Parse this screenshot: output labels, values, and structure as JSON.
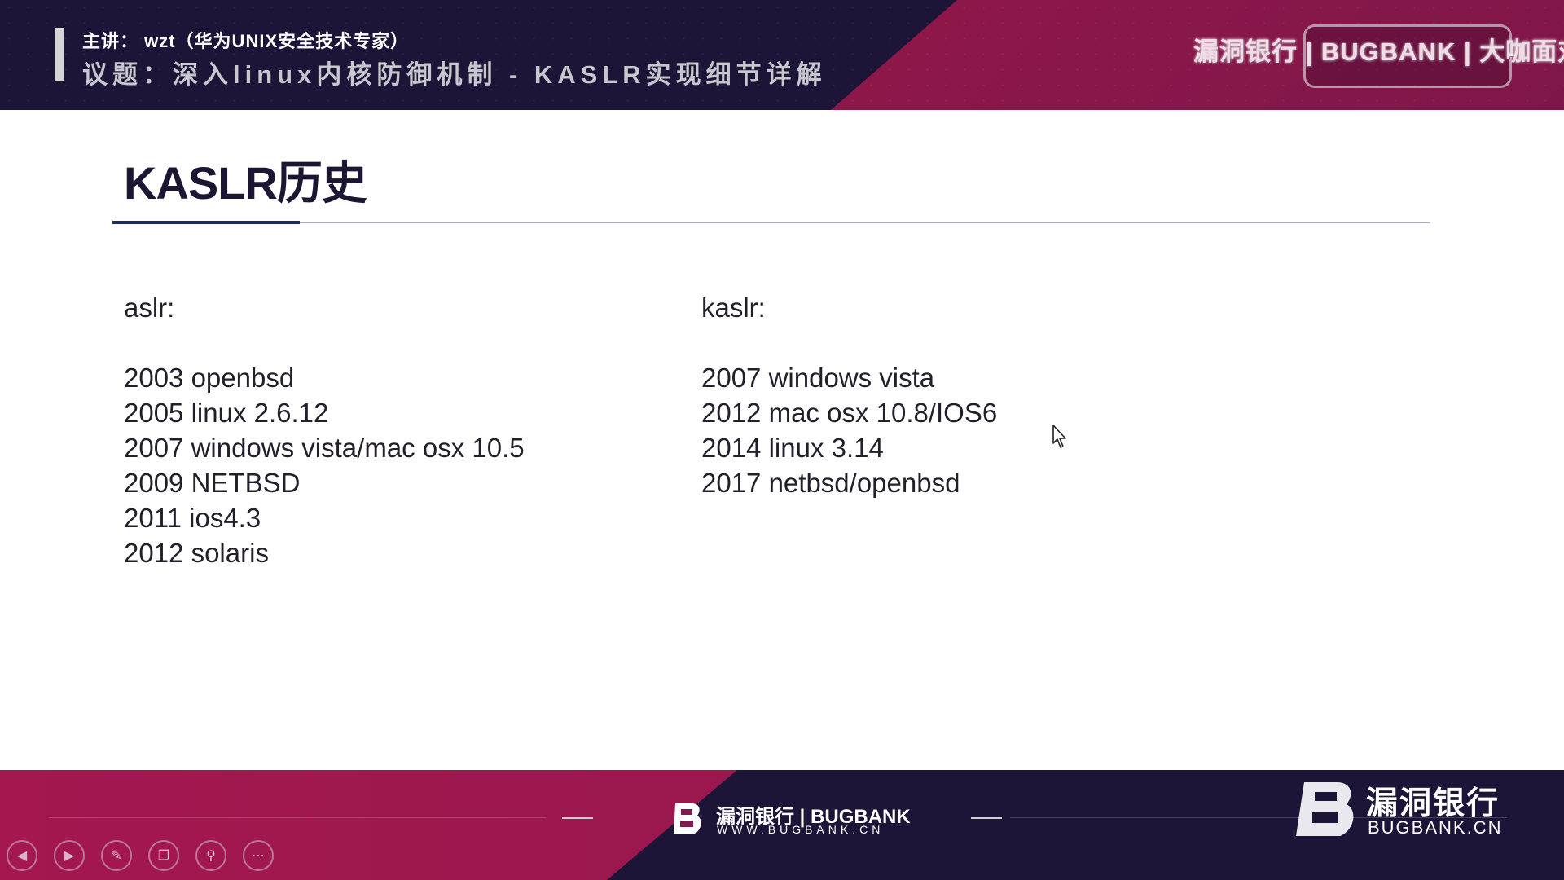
{
  "banner": {
    "speaker": "主讲：  wzt（华为UNIX安全技术专家）",
    "topic": "议题：深入linux内核防御机制 - KASLR实现细节详解",
    "logo_text": "漏洞银行 | BUGBANK | 大咖面对面"
  },
  "slide": {
    "title": "KASLR历史",
    "left_column": {
      "heading": "aslr:",
      "items": [
        "2003 openbsd",
        "2005 linux 2.6.12",
        "2007 windows vista/mac osx 10.5",
        "2009 NETBSD",
        "2011 ios4.3",
        "2012 solaris"
      ]
    },
    "right_column": {
      "heading": "kaslr:",
      "items": [
        "2007 windows vista",
        "2012 mac osx 10.8/IOS6",
        "2014 linux 3.14",
        "2017 netbsd/openbsd"
      ]
    }
  },
  "footer": {
    "center_logo_name": "漏洞银行 | BUGBANK",
    "center_logo_url": "WWW.BUGBANK.CN",
    "right_logo_name": "漏洞银行",
    "right_logo_sub": "BUGBANK.CN"
  },
  "controls": [
    {
      "name": "previous-icon",
      "glyph": "◀"
    },
    {
      "name": "next-icon",
      "glyph": "▶"
    },
    {
      "name": "pen-icon",
      "glyph": "✎"
    },
    {
      "name": "slides-icon",
      "glyph": "❐"
    },
    {
      "name": "zoom-icon",
      "glyph": "⚲"
    },
    {
      "name": "more-icon",
      "glyph": "⋯"
    }
  ],
  "colors": {
    "navy": "#1c1537",
    "magenta": "#a3174e",
    "title": "#1d1633",
    "accent": "#1c2d5c"
  }
}
